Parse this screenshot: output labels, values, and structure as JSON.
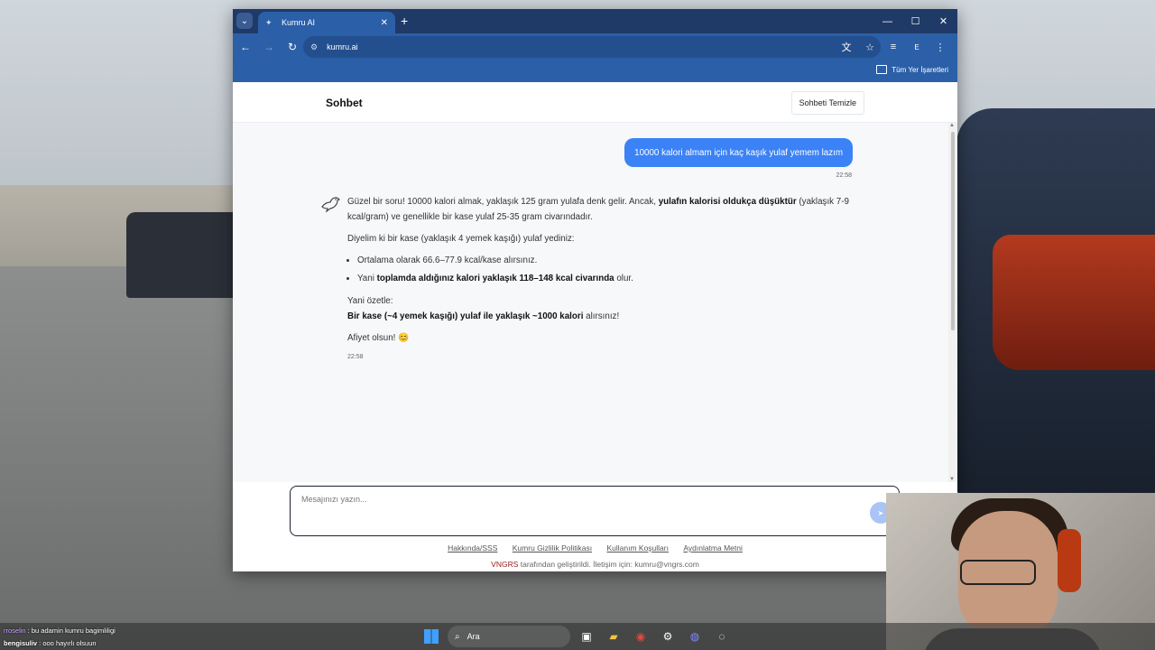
{
  "browser": {
    "tab_title": "Kumru AI",
    "url": "kumru.ai",
    "bookmarks_label": "Tüm Yer İşaretleri",
    "profile_initial": "E"
  },
  "page": {
    "title": "Sohbet",
    "clear_button": "Sohbeti Temizle"
  },
  "messages": {
    "user": {
      "text": "10000 kalori almam için kaç kaşık yulaf yemem lazım",
      "time": "22:58"
    },
    "bot": {
      "p1_a": "Güzel bir soru! 10000 kalori almak, yaklaşık 125 gram yulafa denk gelir. Ancak, ",
      "p1_b": "yulafın kalorisi oldukça düşüktür",
      "p1_c": " (yaklaşık 7-9 kcal/gram) ve genellikle bir kase yulaf 25-35 gram civarındadır.",
      "p2": "Diyelim ki bir kase (yaklaşık 4 yemek kaşığı) yulaf yediniz:",
      "li1": "Ortalama olarak 66.6–77.9 kcal/kase alırsınız.",
      "li2_a": "Yani ",
      "li2_b": "toplamda aldığınız kalori yaklaşık 118–148 kcal civarında",
      "li2_c": " olur.",
      "p3_line1": "Yani özetle:",
      "p3_bold": "Bir kase (~4 yemek kaşığı) yulaf ile yaklaşık ~1000 kalori",
      "p3_rest": " alırsınız!",
      "p4": "Afiyet olsun! 😊",
      "time": "22:58"
    }
  },
  "composer": {
    "placeholder": "Mesajınızı yazın..."
  },
  "footer": {
    "links": [
      "Hakkında/SSS",
      "Kumru Gizlilik Politikası",
      "Kullanım Koşulları",
      "Aydınlatma Metni"
    ],
    "brand": "VNGRS",
    "credit": " tarafından geliştirildi. İletişim için: kumru@vngrs.com"
  },
  "stream_chat": [
    {
      "user": "rroselin",
      "text": " : bu adamin kumru bagimliligi"
    },
    {
      "user": "bengisuliv",
      "text": " : ooo hayırlı olsuun"
    }
  ],
  "taskbar": {
    "search_label": "Ara"
  }
}
